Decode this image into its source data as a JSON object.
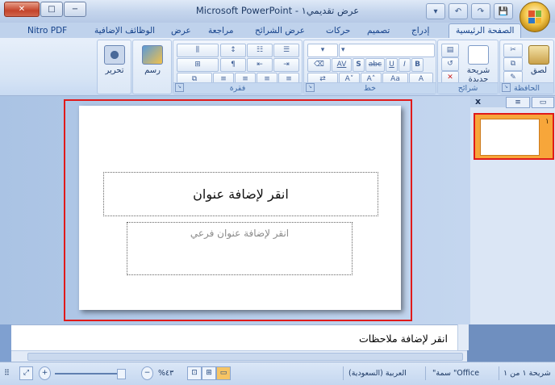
{
  "window": {
    "title": "Microsoft PowerPoint - عرض تقديمي١",
    "controls": {
      "close": "✕",
      "maximize": "□",
      "minimize": "−"
    },
    "qat": {
      "customize": "▾",
      "undo": "↶",
      "redo": "↷",
      "save": "💾"
    }
  },
  "ribbon_tabs": {
    "home": "الصفحة الرئيسية",
    "insert": "إدراج",
    "design": "تصميم",
    "animations": "حركات",
    "slideshow": "عرض الشرائح",
    "review": "مراجعة",
    "view": "عرض",
    "addins": "الوظائف الإضافية",
    "nitro": "Nitro PDF",
    "help": "?"
  },
  "ribbon": {
    "clipboard": {
      "label": "الحافظة",
      "paste": "لصق"
    },
    "slides": {
      "label": "شرائح",
      "new_slide": "شريحة جديدة"
    },
    "font": {
      "label": "خط",
      "bold": "B",
      "italic": "I",
      "underline": "U",
      "strike": "abc",
      "shadow": "S",
      "spacing": "AV",
      "case": "Aa",
      "grow": "A˄",
      "shrink": "A˅",
      "color": "A"
    },
    "paragraph": {
      "label": "فقرة"
    },
    "drawing": {
      "label": "رسم"
    },
    "editing": {
      "label": "تحرير"
    }
  },
  "slide": {
    "title_placeholder": "انقر لإضافة عنوان",
    "subtitle_placeholder": "انقر لإضافة عنوان فرعي"
  },
  "panel": {
    "close": "x",
    "thumb_number": "١"
  },
  "notes": {
    "placeholder": "انقر لإضافة ملاحظات"
  },
  "status": {
    "slide_info": "شريحة ١ من ١",
    "theme": "\"سمة \"Office",
    "language": "العربية (السعودية)",
    "zoom": "%٤٣"
  },
  "colors": {
    "accent": "#15428b",
    "selection": "#e01a1a",
    "thumb_bg": "#f7a63a"
  }
}
